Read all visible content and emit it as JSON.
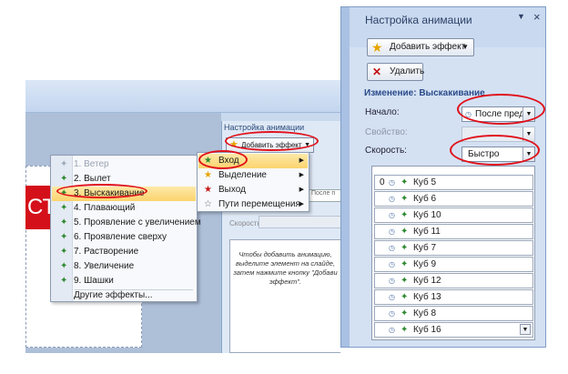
{
  "left": {
    "title_fragment": "СТ",
    "task_pane_title": "Настройка анимации",
    "add_effect_label": "Добавить эффект",
    "field_fragment": "После п",
    "speed_label": "Скорость:",
    "hint_text": "Чтобы добавить анимацию, выделите элемент на слайде, затем нажмите кнопку \"Добави эффект\".",
    "menu_items": [
      {
        "label": "1. Ветер"
      },
      {
        "label": "2. Вылет"
      },
      {
        "label": "3. Выскакивание"
      },
      {
        "label": "4. Плавающий"
      },
      {
        "label": "5. Проявление с увеличением"
      },
      {
        "label": "6. Проявление сверху"
      },
      {
        "label": "7. Растворение"
      },
      {
        "label": "8. Увеличение"
      },
      {
        "label": "9. Шашки"
      }
    ],
    "menu_other": "Другие эффекты...",
    "submenu_items": [
      {
        "label": "Вход",
        "icon": "star-green-icon"
      },
      {
        "label": "Выделение",
        "icon": "star-yellow-icon"
      },
      {
        "label": "Выход",
        "icon": "star-red-icon"
      },
      {
        "label": "Пути перемещения",
        "icon": "star-outline-icon"
      }
    ]
  },
  "right": {
    "title": "Настройка анимации",
    "add_effect": "Добавить эффект",
    "delete": "Удалить",
    "change_label": "Изменение: Выскакивание",
    "start_label": "Начало:",
    "start_value": "После пред",
    "property_label": "Свойство:",
    "speed_label": "Скорость:",
    "speed_value": "Быстро",
    "animations": [
      {
        "num": "0",
        "name": "Куб 5"
      },
      {
        "num": "",
        "name": "Куб 6"
      },
      {
        "num": "",
        "name": "Куб 10"
      },
      {
        "num": "",
        "name": "Куб 11"
      },
      {
        "num": "",
        "name": "Куб 7"
      },
      {
        "num": "",
        "name": "Куб 9"
      },
      {
        "num": "",
        "name": "Куб 12"
      },
      {
        "num": "",
        "name": "Куб 13"
      },
      {
        "num": "",
        "name": "Куб 8"
      },
      {
        "num": "",
        "name": "Куб 16"
      }
    ]
  },
  "colors": {
    "highlight": "#fbd46e",
    "oval": "#e0101a",
    "title_red": "#d4101a",
    "heading_blue": "#2a4b8a"
  }
}
